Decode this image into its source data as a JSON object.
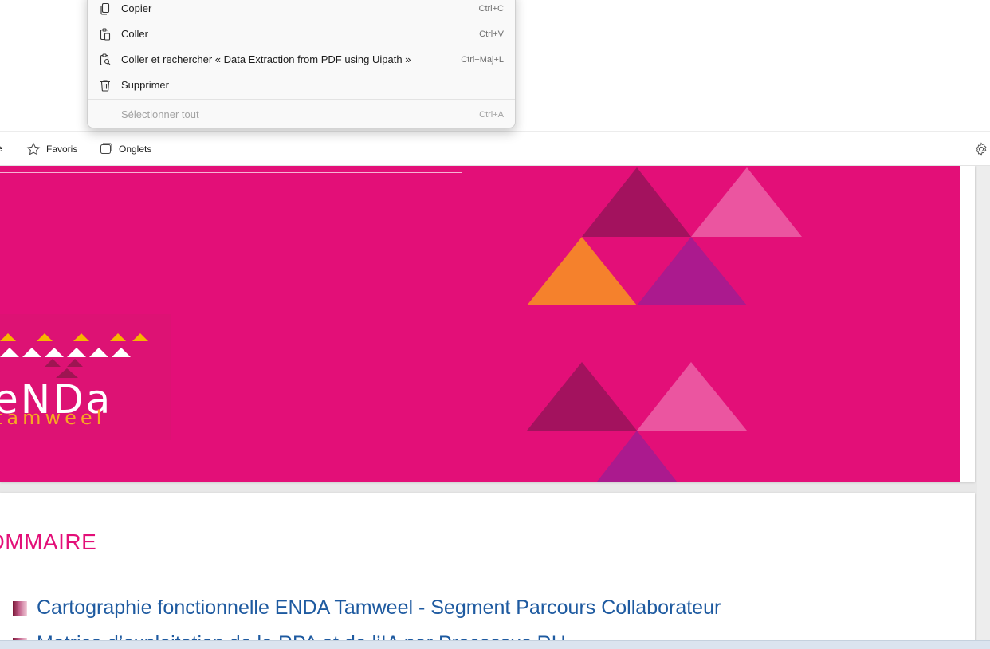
{
  "context_menu": {
    "items": [
      {
        "label": "Copier",
        "shortcut": "Ctrl+C",
        "icon": "copy-icon",
        "enabled": true
      },
      {
        "label": "Coller",
        "shortcut": "Ctrl+V",
        "icon": "paste-icon",
        "enabled": true
      },
      {
        "label": "Coller et rechercher « Data Extraction from PDF using Uipath »",
        "shortcut": "Ctrl+Maj+L",
        "icon": "paste-search-icon",
        "enabled": true
      },
      {
        "label": "Supprimer",
        "shortcut": "",
        "icon": "trash-icon",
        "enabled": true
      },
      {
        "label": "Sélectionner tout",
        "shortcut": "Ctrl+A",
        "icon": "",
        "enabled": false
      }
    ]
  },
  "favorites_bar": {
    "cut_item": "e",
    "favorites_label": "Favoris",
    "tabs_label": "Onglets",
    "settings_icon": "gear-icon"
  },
  "slide1": {
    "logo_line1": "eNDa",
    "logo_line2": "tamweel",
    "background_color": "#e30f78",
    "accent_colors": [
      "#a3125e",
      "#eb55a0",
      "#f5812c",
      "#ab1a8e",
      "#f7b500"
    ]
  },
  "slide2": {
    "heading": "OMMAIRE",
    "items": [
      "Cartographie fonctionnelle ENDA Tamweel - Segment Parcours Collaborateur",
      "Matrice d’exploitation de la RPA et de l’IA par Processus RH"
    ]
  }
}
